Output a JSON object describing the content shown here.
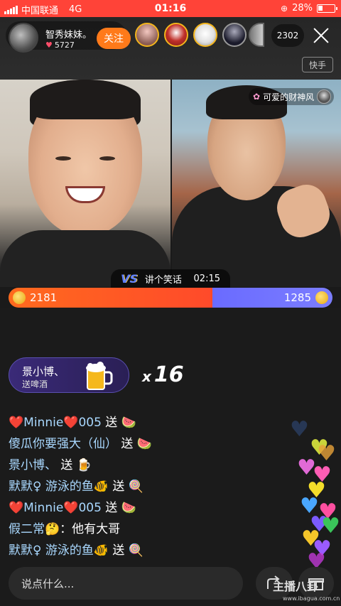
{
  "status_bar": {
    "carrier": "中国联通",
    "network": "4G",
    "time": "01:16",
    "battery": "28%",
    "battery_level": 0.28
  },
  "host": {
    "name": "智秀妹妹。",
    "likes": "5727",
    "follow_label": "关注"
  },
  "viewers": {
    "count": "2302"
  },
  "platform_tag": "快手",
  "guest": {
    "name": "可爱的财神风"
  },
  "pk": {
    "topic": "讲个笑话",
    "timer": "02:15",
    "left_score": "2181",
    "right_score": "1285",
    "left_share": 0.63
  },
  "gift": {
    "sender": "景小博、",
    "description": "送啤酒",
    "count": "16",
    "count_prefix": "x"
  },
  "chat": [
    {
      "nick": "❤️Minnie❤️005",
      "text": " 送 ",
      "emoji": "🍉"
    },
    {
      "nick": "傻瓜你要强大（仙）",
      "text": " 送 ",
      "emoji": "🍉"
    },
    {
      "nick": "景小博、",
      "text": " 送 ",
      "emoji": "🍺"
    },
    {
      "nick": "默默♀ 游泳的鱼🐠",
      "text": " 送 ",
      "emoji": "🍭"
    },
    {
      "nick": "❤️Minnie❤️005",
      "text": " 送 ",
      "emoji": "🍉"
    },
    {
      "nick": "假二常🤔",
      "text": "：他有大哥",
      "emoji": ""
    },
    {
      "nick": "默默♀ 游泳的鱼🐠",
      "text": " 送 ",
      "emoji": "🍭"
    }
  ],
  "input": {
    "placeholder": "说点什么..."
  },
  "watermark": {
    "text": "主播八卦",
    "url": "www.ibagua.com.cn"
  },
  "colors": {
    "status_bar": "#ff4338",
    "follow": "#ff7a1a",
    "pk_left": "#ff5a24",
    "pk_right": "#7274ff",
    "nick": "#a9d8ff"
  },
  "icons": {
    "close": "close-icon",
    "vs": "vs-icon",
    "coin": "coin-icon",
    "beer": "beer-icon",
    "share": "share-icon",
    "gift": "gift-icon"
  }
}
